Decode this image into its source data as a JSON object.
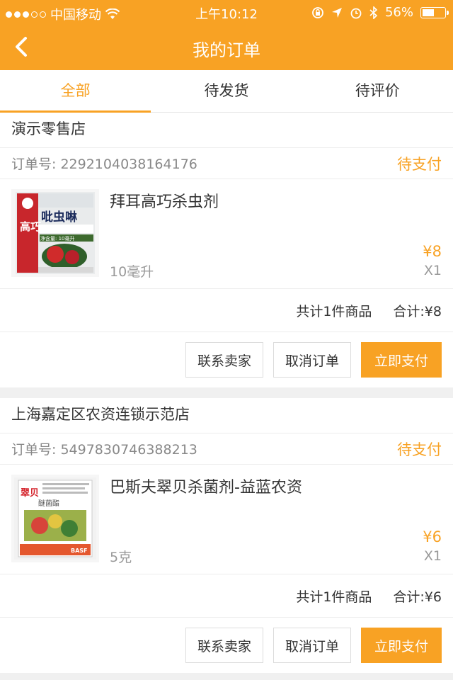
{
  "status_bar": {
    "carrier": "中国移动",
    "time": "上午10:12",
    "battery": "56%",
    "battery_level": 0.56,
    "signal_bars": 3
  },
  "nav": {
    "title": "我的订单",
    "back_icon": "chevron-left-icon"
  },
  "tabs": [
    {
      "label": "全部",
      "active": true
    },
    {
      "label": "待发货",
      "active": false
    },
    {
      "label": "待评价",
      "active": false
    }
  ],
  "orders": [
    {
      "shop": "演示零售店",
      "order_no_label": "订单号:",
      "order_no": "2292104038164176",
      "status": "待支付",
      "product_name": "拜耳高巧杀虫剂",
      "spec": "10毫升",
      "price": "¥8",
      "qty": "X1",
      "count_text": "共计1件商品",
      "total_text": "合计:¥8",
      "buttons": {
        "contact": "联系卖家",
        "cancel": "取消订单",
        "pay": "立即支付"
      },
      "thumb_text": {
        "brand": "高巧",
        "name": "吡虫啉",
        "vol": "净含量: 10毫升"
      }
    },
    {
      "shop": "上海嘉定区农资连锁示范店",
      "order_no_label": "订单号:",
      "order_no": "5497830746388213",
      "status": "待支付",
      "product_name": "巴斯夫翠贝杀菌剂-益蓝农资",
      "spec": "5克",
      "price": "¥6",
      "qty": "X1",
      "count_text": "共计1件商品",
      "total_text": "合计:¥6",
      "buttons": {
        "contact": "联系卖家",
        "cancel": "取消订单",
        "pay": "立即支付"
      },
      "thumb_text": {
        "brand": "翠贝",
        "name": "醚菌酯",
        "maker": "BASF"
      }
    }
  ],
  "colors": {
    "accent": "#f8a224",
    "text": "#333333",
    "muted": "#999999"
  }
}
